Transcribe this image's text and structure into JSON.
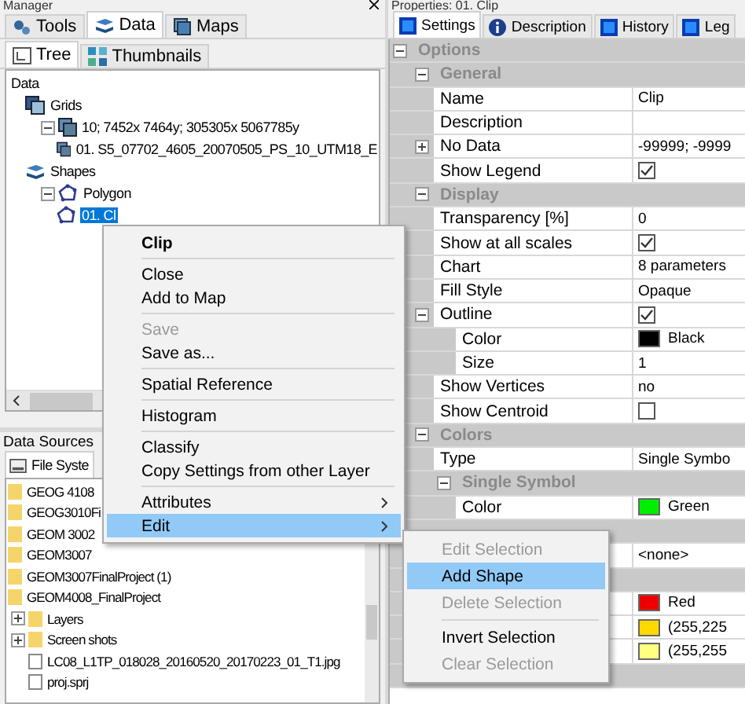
{
  "left_panel": {
    "title": "Manager",
    "tabs": [
      {
        "label": "Tools",
        "selected": false
      },
      {
        "label": "Data",
        "selected": true
      },
      {
        "label": "Maps",
        "selected": false
      }
    ],
    "view_tabs": [
      {
        "label": "Tree",
        "selected": true
      },
      {
        "label": "Thumbnails",
        "selected": false
      }
    ],
    "tree": [
      {
        "label": "Data",
        "children": [
          {
            "label": "Grids",
            "kind": "grids",
            "children": [
              {
                "label": "10; 7452x 7464y; 305305x 5067785y",
                "kind": "grid",
                "expanded": true,
                "children": [
                  {
                    "label": "01. S5_07702_4605_20070505_PS_10_UTM18_E",
                    "kind": "grid",
                    "selected": false
                  }
                ]
              }
            ]
          },
          {
            "label": "Shapes",
            "kind": "shapes",
            "children": [
              {
                "label": "Polygon",
                "kind": "polygon",
                "expanded": true,
                "children": [
                  {
                    "label": "01. Cl",
                    "kind": "polygon",
                    "selected": true
                  }
                ]
              }
            ]
          }
        ]
      }
    ]
  },
  "sources_panel": {
    "title": "Data Sources",
    "tabs": [
      {
        "label": "File Syste",
        "selected": true
      }
    ],
    "files": [
      {
        "label": "GEOG 4108",
        "kind": "folder"
      },
      {
        "label": "GEOG3010Fi",
        "kind": "folder"
      },
      {
        "label": "GEOM 3002",
        "kind": "folder"
      },
      {
        "label": "GEOM3007",
        "kind": "folder"
      },
      {
        "label": "GEOM3007FinalProject (1)",
        "kind": "folder"
      },
      {
        "label": "GEOM4008_FinalProject",
        "kind": "folder",
        "children": [
          {
            "label": "Layers",
            "kind": "folder",
            "expanded": false
          },
          {
            "label": "Screen shots",
            "kind": "folder",
            "expanded": false
          },
          {
            "label": "LC08_L1TP_018028_20160520_20170223_01_T1.jpg",
            "kind": "file"
          },
          {
            "label": "proj.sprj",
            "kind": "file"
          }
        ]
      }
    ]
  },
  "properties": {
    "title": "Properties: 01. Clip",
    "tabs": [
      {
        "label": "Settings",
        "selected": true
      },
      {
        "label": "Description",
        "selected": false
      },
      {
        "label": "History",
        "selected": false
      },
      {
        "label": "Leg",
        "selected": false
      }
    ],
    "rows": [
      {
        "kind": "category",
        "label": "Options",
        "expanded": true
      },
      {
        "kind": "subcategory",
        "label": "General",
        "expanded": true
      },
      {
        "kind": "row",
        "label": "Name",
        "value": "Clip"
      },
      {
        "kind": "row",
        "label": "Description"
      },
      {
        "kind": "row",
        "label": "No Data",
        "value": "-99999; -9999",
        "expanded": false
      },
      {
        "kind": "row",
        "label": "Show Legend",
        "checked": true
      },
      {
        "kind": "subcategory",
        "label": "Display",
        "expanded": true
      },
      {
        "kind": "row",
        "label": "Transparency [%]",
        "value": "0"
      },
      {
        "kind": "row",
        "label": "Show at all scales",
        "checked": true
      },
      {
        "kind": "row",
        "label": "Chart",
        "value": "8 parameters"
      },
      {
        "kind": "row",
        "label": "Fill Style",
        "value": "Opaque"
      },
      {
        "kind": "row",
        "label": "Outline",
        "checked": true,
        "expanded": true
      },
      {
        "kind": "subrow",
        "label": "Color",
        "value": "Black",
        "color": "#000000"
      },
      {
        "kind": "subrow",
        "label": "Size",
        "value": "1"
      },
      {
        "kind": "row",
        "label": "Show Vertices",
        "value": "no"
      },
      {
        "kind": "row",
        "label": "Show Centroid",
        "checked": false
      },
      {
        "kind": "subcategory",
        "label": "Colors",
        "expanded": true
      },
      {
        "kind": "row",
        "label": "Type",
        "value": "Single Symbo"
      },
      {
        "kind": "subsub",
        "label": "Single Symbol",
        "expanded": true
      },
      {
        "kind": "subrow",
        "label": "Color",
        "value": "Green",
        "color": "#00ee00"
      },
      {
        "kind": "subcategory"
      },
      {
        "kind": "row",
        "value": "<none>"
      },
      {
        "kind": "subcategory"
      },
      {
        "kind": "row",
        "value": "Red",
        "color": "#ee0000"
      },
      {
        "kind": "row",
        "value": "(255,225",
        "color": "#ffd800"
      },
      {
        "kind": "row",
        "value": "(255,255",
        "color": "#ffff80"
      },
      {
        "kind": "subcategory"
      }
    ]
  },
  "context_menu": {
    "items": [
      {
        "label": "Clip",
        "kind": "title"
      },
      {
        "kind": "separator"
      },
      {
        "label": "Close",
        "kind": "item"
      },
      {
        "label": "Add to Map",
        "kind": "item"
      },
      {
        "kind": "separator"
      },
      {
        "label": "Save",
        "kind": "item",
        "disabled": true
      },
      {
        "label": "Save as...",
        "kind": "item"
      },
      {
        "kind": "separator"
      },
      {
        "label": "Spatial Reference",
        "kind": "item"
      },
      {
        "kind": "separator"
      },
      {
        "label": "Histogram",
        "kind": "item"
      },
      {
        "kind": "separator"
      },
      {
        "label": "Classify",
        "kind": "item"
      },
      {
        "label": "Copy Settings from other Layer",
        "kind": "item"
      },
      {
        "kind": "separator"
      },
      {
        "label": "Attributes",
        "kind": "submenu",
        "selected": false
      },
      {
        "label": "Edit",
        "kind": "submenu",
        "selected": true
      }
    ]
  },
  "submenu": {
    "items": [
      {
        "label": "Edit Selection",
        "kind": "item",
        "disabled": true,
        "selected": false
      },
      {
        "label": "Add Shape",
        "kind": "item",
        "disabled": false,
        "selected": true
      },
      {
        "label": "Delete Selection",
        "kind": "item",
        "disabled": true,
        "selected": false
      },
      {
        "kind": "separator"
      },
      {
        "label": "Invert Selection",
        "kind": "item",
        "disabled": false,
        "selected": false
      },
      {
        "label": "Clear Selection",
        "kind": "item",
        "disabled": true,
        "selected": false
      }
    ]
  }
}
